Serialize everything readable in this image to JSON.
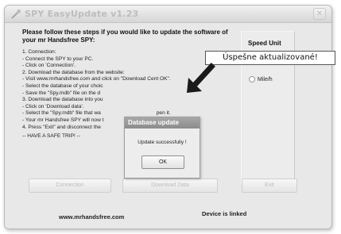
{
  "window": {
    "title": "SPY EasyUpdate v1.23",
    "close_glyph": "✕",
    "app_icon": "wrench-icon"
  },
  "instructions": {
    "intro": "Please follow these steps if you would like to update the software of your mr Handsfree SPY:",
    "steps": [
      "1. Connection:",
      "- Connect the SPY to your PC.",
      "- Click on 'Connection'.",
      "2. Download the database from the website:",
      "- Visit www.mrhandsfree.com and click on \"Download Cent",
      "- Select the database of your choic",
      "- Save the \"Spy.mdb\" file on the d",
      "3. Download the database into you",
      "- Click on 'Download data'.",
      "- Select the \"Spy.mdb\" file that wa",
      "- Your mr Handsfree SPY will now t",
      "4. Press \"Exit\" and disconnect the",
      "",
      "-- HAVE A SAFE TRIP! --"
    ],
    "fragment_ok": "OK\".",
    "fragment_open": "pen it."
  },
  "speed_unit": {
    "title": "Speed Unit",
    "option_label": "Mile/h"
  },
  "buttons": {
    "connection": "Connection",
    "download_data": "Download Data",
    "exit": "Exit"
  },
  "footer": {
    "website": "www.mrhandsfree.com",
    "status": "Device is linked"
  },
  "dialog": {
    "title": "Database update",
    "message": "Update successfully !",
    "ok_label": "OK"
  },
  "callout": {
    "text": "Úspešne aktualizované!"
  },
  "colors": {
    "dialog_title_bar": "#999999",
    "arrow": "#1a1a1a"
  }
}
